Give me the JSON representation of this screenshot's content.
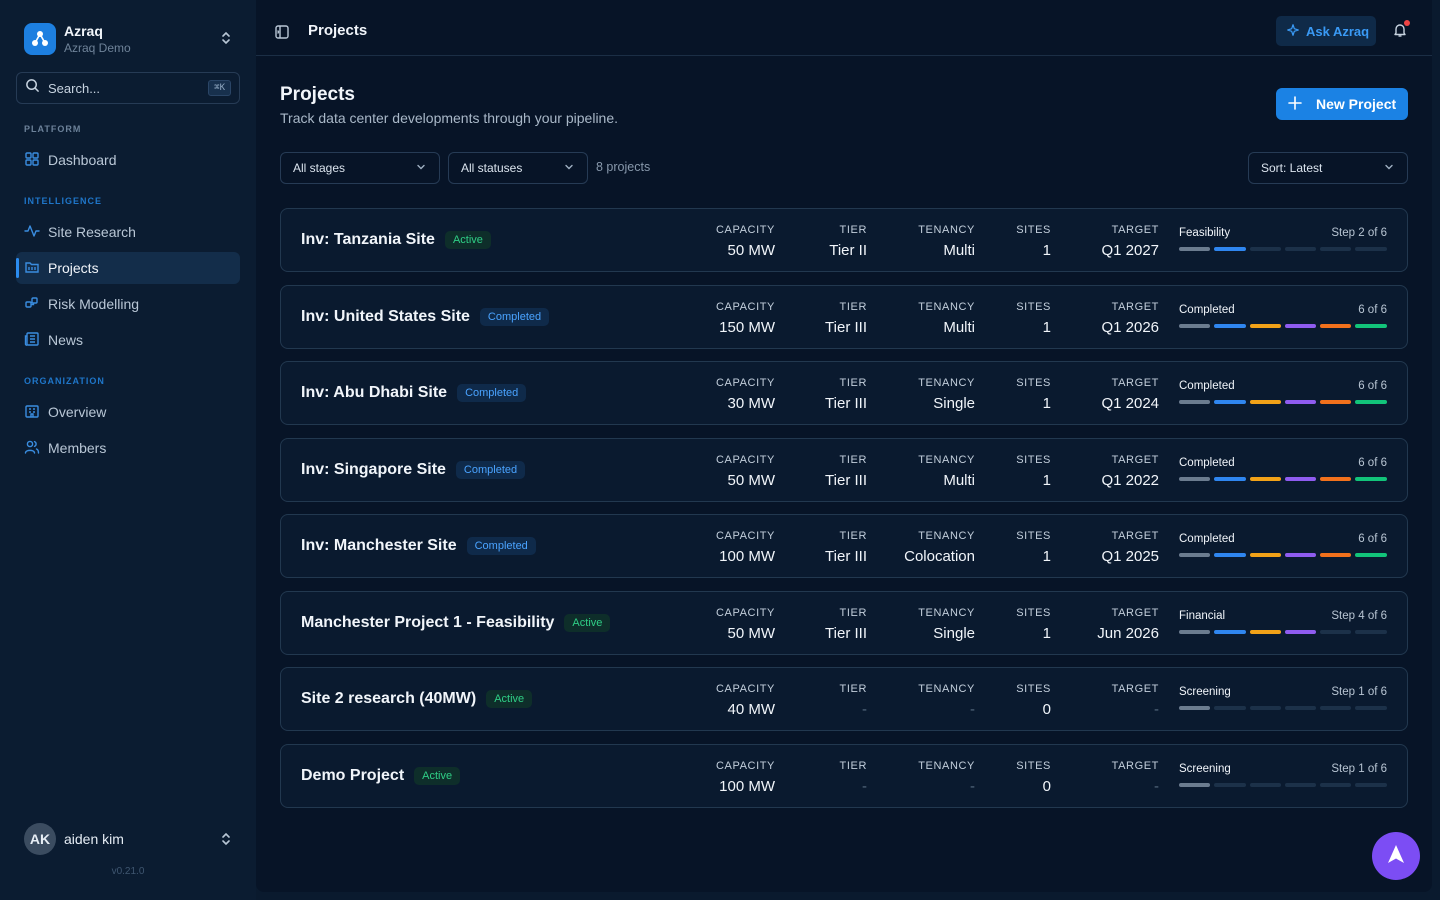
{
  "workspace": {
    "name": "Azraq",
    "sub": "Azraq Demo"
  },
  "search": {
    "placeholder": "Search...",
    "shortcut": "⌘K"
  },
  "sidebar": {
    "sections": [
      {
        "label": "PLATFORM",
        "color": "#6c8199"
      },
      {
        "label": "INTELLIGENCE",
        "color": "#1f76c9"
      },
      {
        "label": "ORGANIZATION",
        "color": "#1f76c9"
      }
    ],
    "items": [
      {
        "label": "Dashboard",
        "icon": "grid-icon"
      },
      {
        "label": "Site Research",
        "icon": "activity-icon"
      },
      {
        "label": "Projects",
        "icon": "folder-icon",
        "active": true
      },
      {
        "label": "Risk Modelling",
        "icon": "cubes-icon"
      },
      {
        "label": "News",
        "icon": "newspaper-icon"
      },
      {
        "label": "Overview",
        "icon": "building-icon"
      },
      {
        "label": "Members",
        "icon": "users-icon"
      }
    ]
  },
  "user": {
    "initials": "AK",
    "name": "aiden kim"
  },
  "version": "v0.21.0",
  "topbar": {
    "title": "Projects",
    "ask_label": "Ask Azraq"
  },
  "page": {
    "title": "Projects",
    "subtitle": "Track data center developments through your pipeline.",
    "new_button": "New Project"
  },
  "filters": {
    "stage": "All stages",
    "status": "All statuses",
    "count": "8 projects",
    "sort": "Sort: Latest"
  },
  "column_headers": {
    "capacity": "CAPACITY",
    "tier": "TIER",
    "tenancy": "TENANCY",
    "sites": "SITES",
    "target": "TARGET"
  },
  "stage_colors": [
    "#6b7c8f",
    "#2f86f0",
    "#f2a218",
    "#8f5cf0",
    "#f2711c",
    "#12c47a"
  ],
  "projects": [
    {
      "name": "Inv: Tanzania Site",
      "status": "Active",
      "capacity": "50 MW",
      "tier": "Tier II",
      "tenancy": "Multi",
      "sites": "1",
      "target": "Q1 2027",
      "stage": "Feasibility",
      "step": "Step 2 of 6",
      "progress": 2
    },
    {
      "name": "Inv: United States Site",
      "status": "Completed",
      "capacity": "150 MW",
      "tier": "Tier III",
      "tenancy": "Multi",
      "sites": "1",
      "target": "Q1 2026",
      "stage": "Completed",
      "step": "6 of 6",
      "progress": 6
    },
    {
      "name": "Inv: Abu Dhabi Site",
      "status": "Completed",
      "capacity": "30 MW",
      "tier": "Tier III",
      "tenancy": "Single",
      "sites": "1",
      "target": "Q1 2024",
      "stage": "Completed",
      "step": "6 of 6",
      "progress": 6
    },
    {
      "name": "Inv: Singapore Site",
      "status": "Completed",
      "capacity": "50 MW",
      "tier": "Tier III",
      "tenancy": "Multi",
      "sites": "1",
      "target": "Q1 2022",
      "stage": "Completed",
      "step": "6 of 6",
      "progress": 6
    },
    {
      "name": "Inv: Manchester Site",
      "status": "Completed",
      "capacity": "100 MW",
      "tier": "Tier III",
      "tenancy": "Colocation",
      "sites": "1",
      "target": "Q1 2025",
      "stage": "Completed",
      "step": "6 of 6",
      "progress": 6
    },
    {
      "name": "Manchester Project 1 - Feasibility",
      "status": "Active",
      "capacity": "50 MW",
      "tier": "Tier III",
      "tenancy": "Single",
      "sites": "1",
      "target": "Jun 2026",
      "stage": "Financial",
      "step": "Step 4 of 6",
      "progress": 4
    },
    {
      "name": "Site 2 research (40MW)",
      "status": "Active",
      "capacity": "40 MW",
      "tier": "-",
      "tenancy": "-",
      "sites": "0",
      "target": "-",
      "stage": "Screening",
      "step": "Step 1 of 6",
      "progress": 1
    },
    {
      "name": "Demo Project",
      "status": "Active",
      "capacity": "100 MW",
      "tier": "-",
      "tenancy": "-",
      "sites": "0",
      "target": "-",
      "stage": "Screening",
      "step": "Step 1 of 6",
      "progress": 1
    }
  ]
}
